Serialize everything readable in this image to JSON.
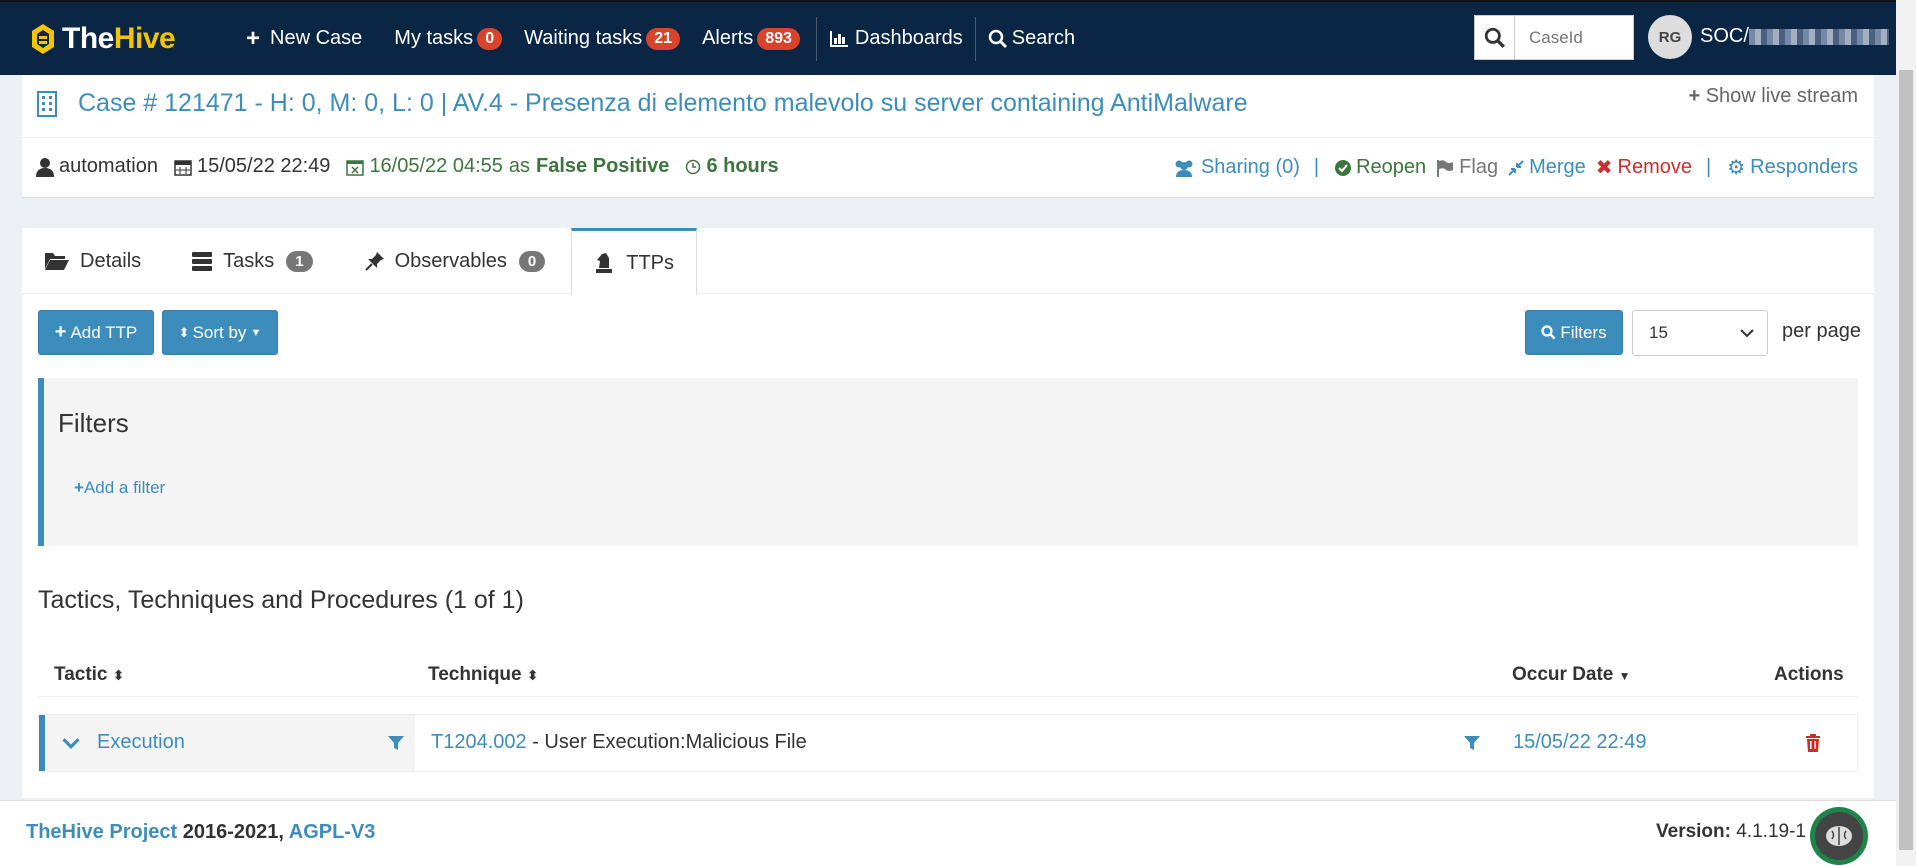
{
  "nav": {
    "brand_the": "The",
    "brand_hive": "Hive",
    "new_case": "New Case",
    "my_tasks": "My tasks",
    "my_tasks_count": "0",
    "waiting_tasks": "Waiting tasks",
    "waiting_tasks_count": "21",
    "alerts": "Alerts",
    "alerts_count": "893",
    "dashboards": "Dashboards",
    "search": "Search",
    "caseid_placeholder": "CaseId",
    "user_initials": "RG",
    "user_name": "SOC/"
  },
  "case": {
    "title": "Case # 121471 - H: 0, M: 0, L: 0 | AV.4 - Presenza di elemento malevolo su server containing AntiMalware",
    "show_live_stream": "Show live stream",
    "author": "automation",
    "created": "15/05/22 22:49",
    "closed": "16/05/22 04:55",
    "closed_as": "as",
    "resolution": "False Positive",
    "duration": "6 hours",
    "actions": {
      "sharing": "Sharing (0)",
      "reopen": "Reopen",
      "flag": "Flag",
      "merge": "Merge",
      "remove": "Remove",
      "responders": "Responders"
    }
  },
  "tabs": [
    {
      "label": "Details",
      "count": ""
    },
    {
      "label": "Tasks",
      "count": "1"
    },
    {
      "label": "Observables",
      "count": "0"
    },
    {
      "label": "TTPs",
      "count": ""
    }
  ],
  "toolbar": {
    "add_ttp": "Add TTP",
    "sort_by": "Sort by",
    "filters": "Filters",
    "page_size": "15",
    "per_page": "per page"
  },
  "filters_panel": {
    "title": "Filters",
    "add_filter": "Add a filter"
  },
  "ttp_section": {
    "title": "Tactics, Techniques and Procedures (1 of 1)",
    "columns": {
      "tactic": "Tactic",
      "technique": "Technique",
      "occur_date": "Occur Date",
      "actions": "Actions"
    },
    "rows": [
      {
        "tactic": "Execution",
        "technique_id": "T1204.002",
        "technique_name": " - User Execution:Malicious File",
        "occur_date": "15/05/22 22:49"
      }
    ]
  },
  "footer": {
    "project": "TheHive Project",
    "years": " 2016-2021, ",
    "license": "AGPL-V3",
    "version_label": "Version:",
    "version": " 4.1.19-1"
  }
}
